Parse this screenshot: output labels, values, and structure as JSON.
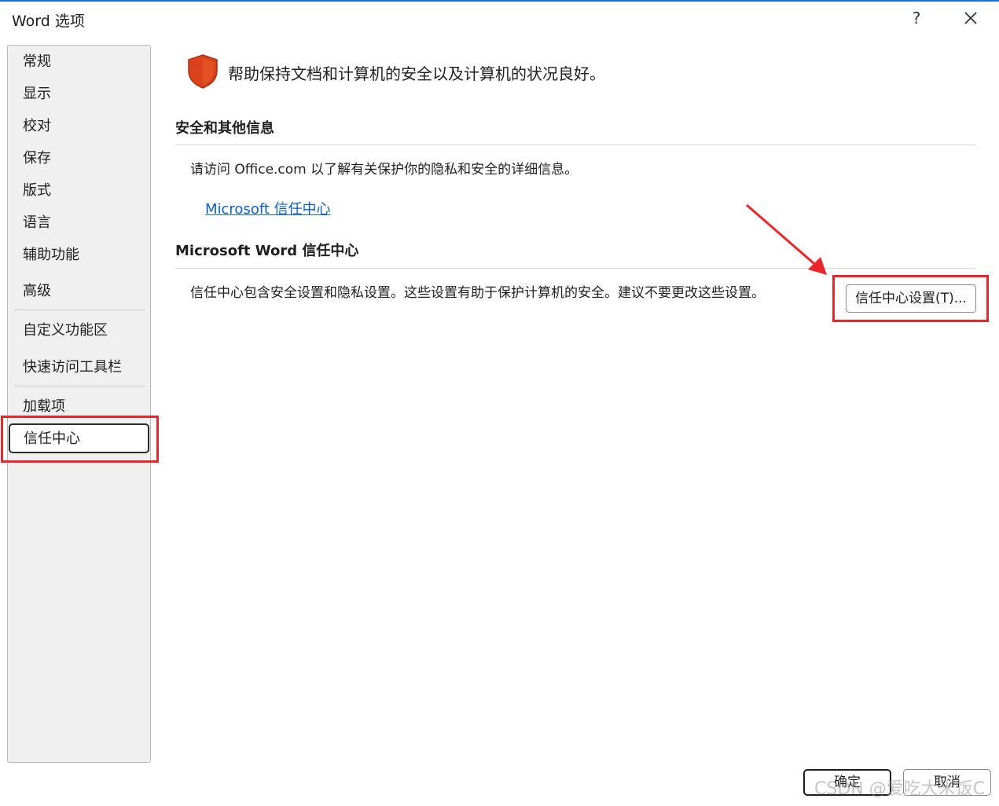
{
  "window": {
    "title": "Word 选项",
    "help_label": "?"
  },
  "sidebar": {
    "items": [
      {
        "label": "常规"
      },
      {
        "label": "显示"
      },
      {
        "label": "校对"
      },
      {
        "label": "保存"
      },
      {
        "label": "版式"
      },
      {
        "label": "语言"
      },
      {
        "label": "辅助功能"
      },
      {
        "label": "高级"
      },
      {
        "label": "自定义功能区"
      },
      {
        "label": "快速访问工具栏"
      },
      {
        "label": "加载项"
      },
      {
        "label": "信任中心"
      }
    ],
    "selected": "信任中心"
  },
  "main": {
    "intro": "帮助保持文档和计算机的安全以及计算机的状况良好。",
    "security_section": {
      "title": "安全和其他信息",
      "text": "请访问 Office.com 以了解有关保护你的隐私和安全的详细信息。",
      "link": "Microsoft 信任中心"
    },
    "trust_center_section": {
      "title": "Microsoft Word 信任中心",
      "text": "信任中心包含安全设置和隐私设置。这些设置有助于保护计算机的安全。建议不要更改这些设置。",
      "button": "信任中心设置(T)..."
    }
  },
  "footer": {
    "ok": "确定",
    "cancel": "取消"
  },
  "watermark": "CSDN @爱吃大米饭C",
  "colors": {
    "accent": "#1d6fd6",
    "link": "#0f5cc0",
    "highlight": "#e8262c",
    "shield": "#d9421b"
  }
}
